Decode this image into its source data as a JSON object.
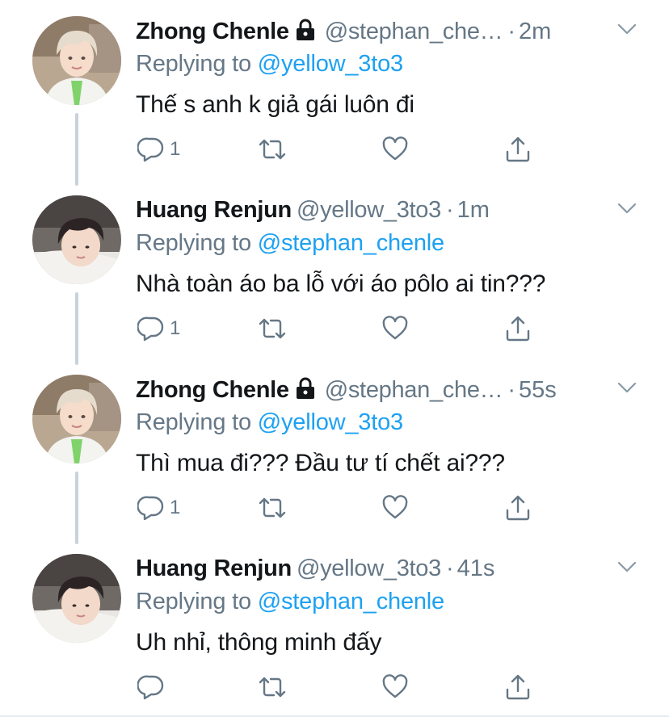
{
  "colors": {
    "name": "#14171a",
    "secondary": "#657786",
    "link": "#1da1f2",
    "thread_line": "#c9d3dc"
  },
  "icons": {
    "reply": "reply-icon",
    "retweet": "retweet-icon",
    "like": "heart-icon",
    "share": "share-icon",
    "more": "chevron-down-icon",
    "protected": "lock-icon"
  },
  "tweets": [
    {
      "name": "Zhong Chenle",
      "protected": true,
      "handle": "@stephan_che…",
      "separator": "·",
      "time": "2m",
      "replying_prefix": "Replying to",
      "replying_to": "@yellow_3to3",
      "text": "Thế s anh k giả gái luôn đi",
      "reply_count": "1"
    },
    {
      "name": "Huang Renjun",
      "protected": false,
      "handle": "@yellow_3to3",
      "separator": "·",
      "time": "1m",
      "replying_prefix": "Replying to",
      "replying_to": "@stephan_chenle",
      "text": "Nhà toàn áo ba lỗ với áo pôlo ai tin???",
      "reply_count": "1"
    },
    {
      "name": "Zhong Chenle",
      "protected": true,
      "handle": "@stephan_che…",
      "separator": "·",
      "time": "55s",
      "replying_prefix": "Replying to",
      "replying_to": "@yellow_3to3",
      "text": "Thì mua đi??? Đầu tư tí chết ai???",
      "reply_count": "1"
    },
    {
      "name": "Huang Renjun",
      "protected": false,
      "handle": "@yellow_3to3",
      "separator": "·",
      "time": "41s",
      "replying_prefix": "Replying to",
      "replying_to": "@stephan_chenle",
      "text": "Uh nhỉ, thông minh đấy",
      "reply_count": ""
    }
  ]
}
